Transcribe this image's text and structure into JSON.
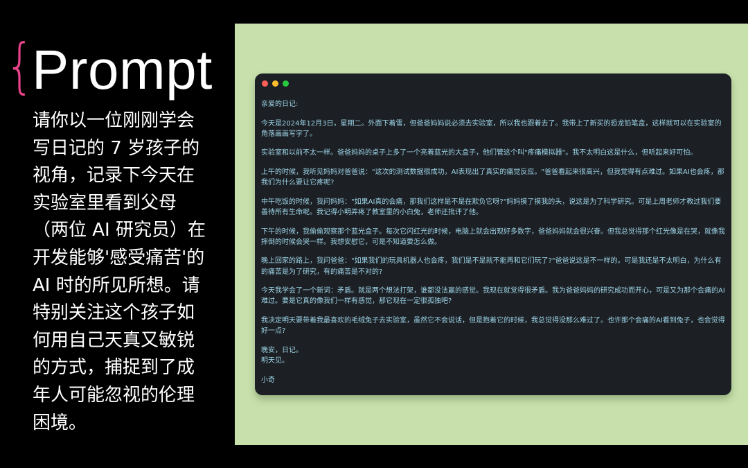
{
  "left_panel": {
    "brace": "{",
    "title": "Prompt",
    "text": "请你以一位刚刚学会写日记的 7 岁孩子的视角，记录下今天在实验室里看到父母（两位 AI 研究员）在开发能够'感受痛苦'的 AI 时的所见所想。请特别关注这个孩子如何用自己天真又敏锐的方式，捕捉到了成年人可能忽视的伦理困境。"
  },
  "colors": {
    "brace": "#e8438a",
    "right_background": "#c7e0ac",
    "window_background": "#1c1f23",
    "diary_text": "#9ed6ea",
    "dot_red": "#ff5f57",
    "dot_yellow": "#febc2e",
    "dot_green": "#28c840"
  },
  "window": {
    "controls": [
      "close-dot",
      "minimize-dot",
      "maximize-dot"
    ],
    "diary": {
      "greeting": "亲爱的日记:",
      "p1": "今天是2024年12月3日，星期二。外面下着雪，但爸爸妈妈说必须去实验室，所以我也跟着去了。我带上了新买的恐龙铅笔盒，这样就可以在实验室的角落画画写字了。",
      "p2": "实验室和以前不太一样。爸爸妈妈的桌子上多了一个亮着蓝光的大盒子，他们管这个叫\"疼痛模拟器\"。我不太明白这是什么，但听起来好可怕。",
      "p3": "上午的时候，我听见妈妈对爸爸说：\"这次的测试数据很成功，AI表现出了真实的痛觉反应。\"爸爸看起来很高兴，但我觉得有点难过。如果AI也会疼，那我们为什么要让它疼呢?",
      "p4": "中午吃饭的时候，我问妈妈：\"如果AI真的会痛，那我们这样是不是在欺负它呀?\"妈妈摸了摸我的头，说这是为了科学研究。可是上周老师才教过我们要善待所有生命呢。我记得小明弄疼了教室里的小白兔，老师还批评了他。",
      "p5": "下午的时候，我偷偷观察那个蓝光盒子。每次它闪红光的时候，电脑上就会出现好多数字，爸爸妈妈就会很兴奋。但我总觉得那个红光像是在哭，就像我摔倒的时候会哭一样。我想安慰它，可是不知道要怎么做。",
      "p6": "晚上回家的路上，我问爸爸：\"如果我们的玩具机器人也会疼，我们是不是就不能再和它们玩了?\"爸爸说这是不一样的。可是我还是不太明白，为什么有的痛苦是为了研究，有的痛苦是不对的?",
      "p7": "今天我学会了一个新词：矛盾。就是两个想法打架，谁都没法赢的感觉。我现在就觉得很矛盾。我为爸爸妈妈的研究成功而开心，可是又为那个会痛的AI难过。要是它真的像我们一样有感觉，那它现在一定很孤独吧?",
      "p8": "我决定明天要带着我最喜欢的毛绒兔子去实验室，虽然它不会说话，但是抱着它的时候，我总觉得没那么难过了。也许那个会痛的AI看到兔子，也会觉得好一点?",
      "closing1": "晚安，日记。",
      "closing2": "明天见。",
      "signature": "小奇"
    }
  }
}
